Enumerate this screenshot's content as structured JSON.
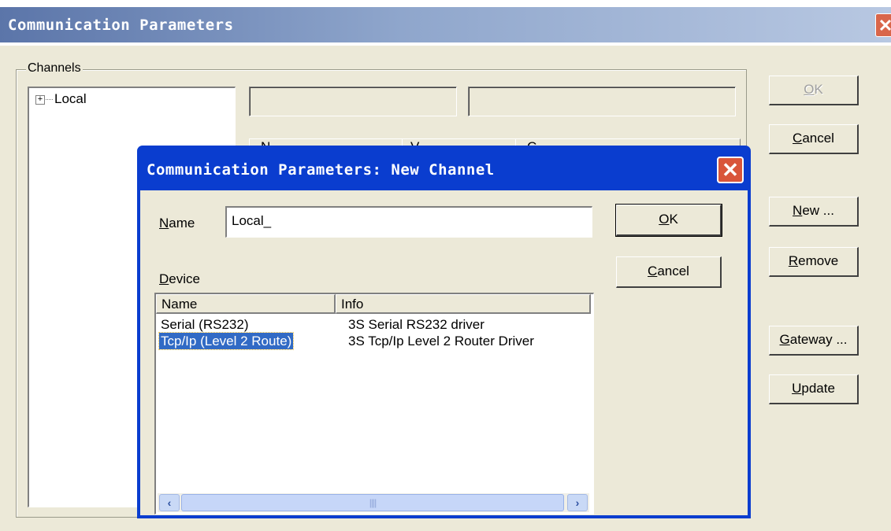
{
  "main_window": {
    "title": "Communication Parameters",
    "close_glyph": "✕",
    "channels_group_label": "Channels",
    "tree": {
      "expander": "+",
      "root_label": "Local"
    },
    "buttons": {
      "ok": {
        "label": "OK",
        "mnemonic": "O",
        "rest": "K",
        "enabled": false
      },
      "cancel": {
        "mnemonic": "C",
        "rest": "ancel"
      },
      "new": {
        "mnemonic": "N",
        "rest": "ew ..."
      },
      "remove": {
        "mnemonic": "R",
        "rest": "emove"
      },
      "gateway": {
        "mnemonic": "G",
        "rest": "ateway ..."
      },
      "update": {
        "mnemonic": "U",
        "rest": "pdate"
      }
    },
    "param_columns_partial": [
      "N",
      "V",
      "C"
    ]
  },
  "dialog": {
    "title": "Communication Parameters: New Channel",
    "close_glyph": "✕",
    "name_label": {
      "mnemonic": "N",
      "rest": "ame"
    },
    "name_value": "Local_",
    "device_label": {
      "mnemonic": "D",
      "rest": "evice"
    },
    "device_list": {
      "columns": [
        "Name",
        "Info"
      ],
      "rows": [
        {
          "name": "Serial (RS232)",
          "info": "3S Serial RS232 driver",
          "selected": false
        },
        {
          "name": "Tcp/Ip (Level 2 Route)",
          "info": "3S Tcp/Ip Level 2 Router Driver",
          "selected": true
        }
      ],
      "scroll_left_icon": "‹",
      "scroll_right_icon": "›",
      "thumb_grip": "||||"
    },
    "buttons": {
      "ok": {
        "mnemonic": "O",
        "rest": "K"
      },
      "cancel": {
        "mnemonic": "C",
        "rest": "ancel"
      }
    },
    "colors": {
      "title_bar": "#0A3DCF",
      "selection": "#316AC5",
      "close": "#D9553A"
    }
  }
}
